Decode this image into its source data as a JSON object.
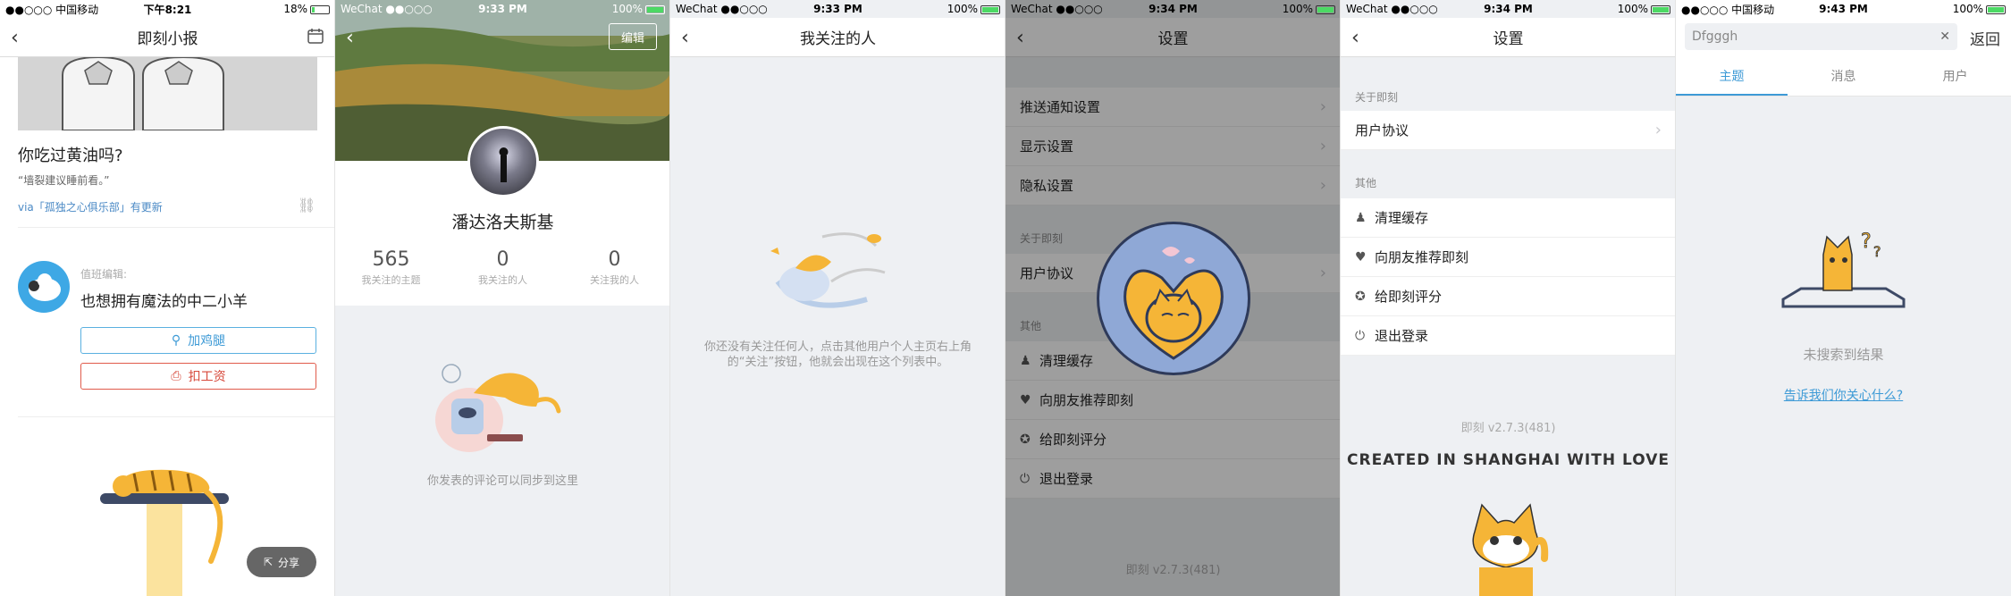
{
  "panel1": {
    "status": {
      "carrier": "●●○○○ 中国移动",
      "time": "下午8:21",
      "battery": "18%"
    },
    "nav_title": "即刻小报",
    "article_title": "你吃过黄油吗?",
    "article_sub": "“墙裂建议睡前看。”",
    "article_source": "via「孤独之心俱乐部」有更新",
    "editor_label": "值班编辑:",
    "editor_name": "也想拥有魔法的中二小羊",
    "btn_add": "加鸡腿",
    "btn_deduct": "扣工资",
    "share": "分享"
  },
  "panel2": {
    "status": {
      "carrier": "WeChat ●●○○○",
      "time": "9:33 PM",
      "battery": "100%"
    },
    "edit": "编辑",
    "name": "潘达洛夫斯基",
    "stats": [
      {
        "num": "565",
        "label": "我关注的主题"
      },
      {
        "num": "0",
        "label": "我关注的人"
      },
      {
        "num": "0",
        "label": "关注我的人"
      }
    ],
    "hint": "你发表的评论可以同步到这里"
  },
  "panel3": {
    "status": {
      "carrier": "WeChat ●●○○○",
      "time": "9:33 PM",
      "battery": "100%"
    },
    "nav_title": "我关注的人",
    "hint_line1": "你还没有关注任何人，点击其他用户个人主页右上角",
    "hint_line2": "的“关注”按钮，他就会出现在这个列表中。"
  },
  "panel4": {
    "status": {
      "carrier": "WeChat ●●○○○",
      "time": "9:34 PM",
      "battery": "100%"
    },
    "nav_title": "设置",
    "cells_top": [
      "推送通知设置",
      "显示设置",
      "隐私设置"
    ],
    "sec_about": "关于即刻",
    "user_agreement": "用户协议",
    "sec_other": "其他",
    "cells_other": [
      "清理缓存",
      "向朋友推荐即刻",
      "给即刻评分",
      "退出登录"
    ],
    "version": "即刻 v2.7.3(481)"
  },
  "panel5": {
    "status": {
      "carrier": "WeChat ●●○○○",
      "time": "9:34 PM",
      "battery": "100%"
    },
    "nav_title": "设置",
    "sec_about": "关于即刻",
    "user_agreement": "用户协议",
    "sec_other": "其他",
    "cells_other": [
      "清理缓存",
      "向朋友推荐即刻",
      "给即刻评分",
      "退出登录"
    ],
    "version": "即刻 v2.7.3(481)",
    "love": "CREATED IN SHANGHAI WITH LOVE"
  },
  "panel6": {
    "status": {
      "carrier": "●●○○○ 中国移动",
      "time": "9:43 PM",
      "battery": "100%"
    },
    "search_value": "Dfgggh",
    "cancel": "返回",
    "tabs": [
      "主题",
      "消息",
      "用户"
    ],
    "no_result": "未搜索到结果",
    "tell_us": "告诉我们你关心什么?"
  }
}
